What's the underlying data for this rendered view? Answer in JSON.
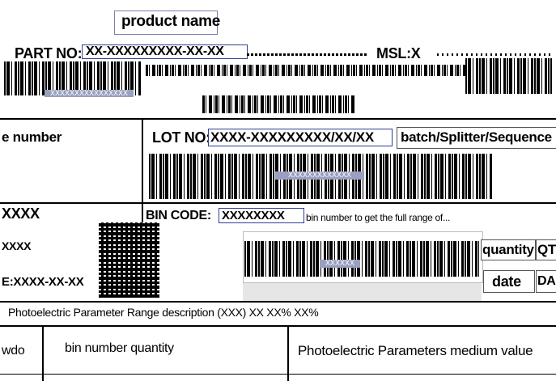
{
  "header": {
    "product_name": "product name",
    "part_no_label": "PART NO:",
    "part_no_value": "XX-XXXXXXXXX-XX-XX",
    "msl_label": "MSL:X"
  },
  "barcodes": {
    "part_barcode_text": "XXXXXXXXXXXXXXXX",
    "lot_barcode_text": "XXXXXXXXXXXXX",
    "qty_barcode_text": "XXXXXX"
  },
  "row2": {
    "left_label": "e number",
    "lot_label": "LOT NO:",
    "lot_value": "XXXX-XXXXXXXXX/XX/XX",
    "batch_label": "batch/Splitter/Sequence"
  },
  "row3": {
    "left_value": "XXXX",
    "bin_code_label": "BIN CODE:",
    "bin_code_value": "XXXXXXXX",
    "note": "bin number to get the full range of..."
  },
  "row4": {
    "left_value": "XXXX",
    "quantity_label": "quantity",
    "quantity_value": "QTY"
  },
  "row5": {
    "left_value": "E:XXXX-XX-XX",
    "date_label": "date",
    "date_value": "DA"
  },
  "row6": {
    "text": "Photoelectric Parameter Range description (XXX) XX XX% XX%"
  },
  "footer": {
    "left_text": "wdo",
    "mid_text": "bin number quantity",
    "right_text": "Photoelectric Parameters medium value"
  }
}
